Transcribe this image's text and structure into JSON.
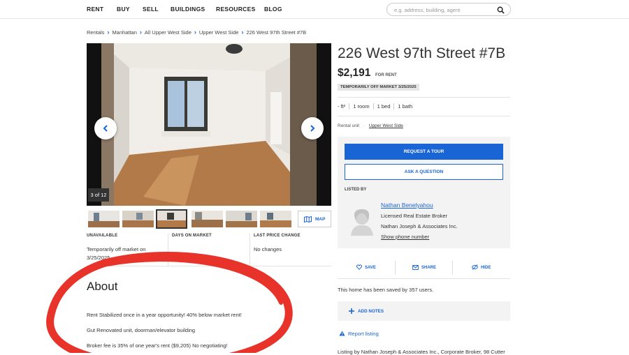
{
  "nav": {
    "items": [
      "RENT",
      "BUY",
      "SELL",
      "BUILDINGS",
      "RESOURCES",
      "BLOG"
    ],
    "search_placeholder": "e.g. address, building, agent",
    "search_icon": "search-icon"
  },
  "breadcrumb": [
    "Rentals",
    "Manhattan",
    "All Upper West Side",
    "Upper West Side",
    "226 West 97th Street #7B"
  ],
  "gallery": {
    "counter": "3 of 12",
    "map_label": "MAP",
    "prev_icon": "chevron-left-icon",
    "next_icon": "chevron-right-icon"
  },
  "facts": {
    "unavailable_label": "UNAVAILABLE",
    "unavailable_value": "Temporarily off market on 3/25/2025",
    "dom_label": "DAYS ON MARKET",
    "dom_value": "",
    "lpc_label": "LAST PRICE CHANGE",
    "lpc_value": "No changes"
  },
  "about": {
    "title": "About",
    "lines": [
      "Rent Stabilized once in a year opportunity! 40% below market rent!",
      "Gut Renovated unit, doorman/elevator building",
      "Broker fee is 35% of one year's rent ($9,205) No negotiating!"
    ]
  },
  "listing": {
    "address": "226 West 97th Street #7B",
    "price": "$2,191",
    "price_suffix": "FOR RENT",
    "status_badge": "TEMPORARILY OFF MARKET 3/25/2025",
    "specs": [
      "- ft²",
      "1 room",
      "1 bed",
      "1 bath"
    ],
    "unit_type": "Rental unit",
    "neighborhood": "Upper West Side",
    "dot": "·"
  },
  "contact": {
    "tour_label": "REQUEST A TOUR",
    "ask_label": "ASK A QUESTION",
    "listed_by_label": "LISTED BY",
    "agent_name": "Nathan Benelyahou",
    "agent_title": "Licensed Real Estate Broker",
    "agent_company": "Nathan Joseph & Associates Inc.",
    "phone_label": "Show phone number"
  },
  "actions": {
    "save": "SAVE",
    "share": "SHARE",
    "hide": "HIDE"
  },
  "saved_text": "This home has been saved by 357 users.",
  "notes_label": "ADD NOTES",
  "report_label": "Report listing",
  "listing_credit": "Listing by Nathan Joseph & Associates Inc., Corporate Broker, 98 Cutter",
  "colors": {
    "accent": "#1a65d6",
    "annotation": "#e8332a"
  }
}
